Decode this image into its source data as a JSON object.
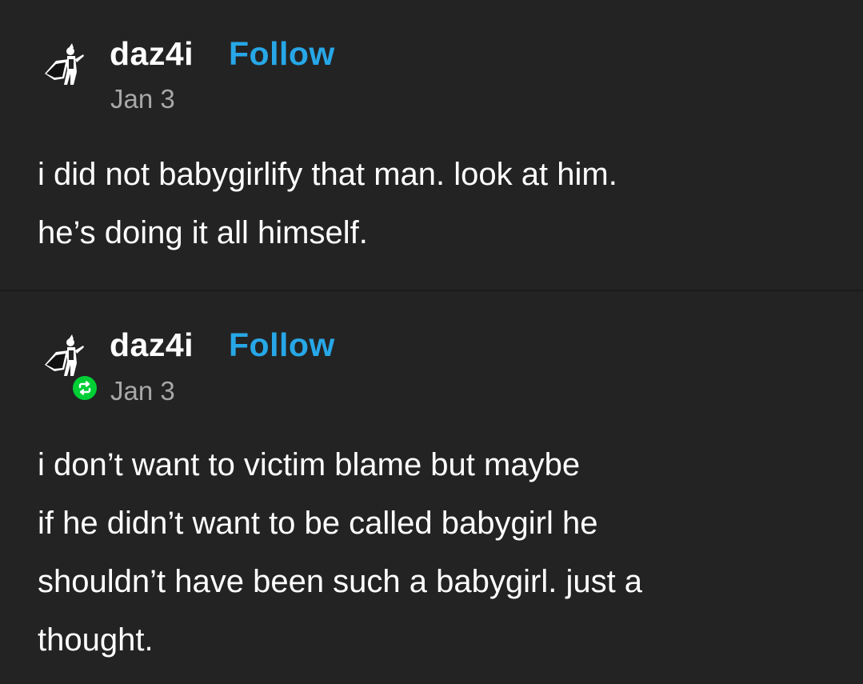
{
  "posts": [
    {
      "username": "daz4i",
      "follow_label": "Follow",
      "date": "Jan 3",
      "avatar_icon": "silhouette-figure-avatar",
      "body": "i did not babygirlify that man. look at him.\nhe’s doing it all himself."
    },
    {
      "username": "daz4i",
      "follow_label": "Follow",
      "date": "Jan 3",
      "avatar_icon": "silhouette-figure-avatar",
      "badge_icon": "reblog-icon",
      "body": "i don’t want to victim blame but maybe\nif he didn’t want to be called babygirl he\nshouldn’t have been such a babygirl. just a\nthought."
    }
  ],
  "colors": {
    "background": "#232323",
    "text": "#ffffff",
    "follow": "#27a7e7",
    "date": "#a8a8a8",
    "reblog_badge": "#00cf35"
  }
}
